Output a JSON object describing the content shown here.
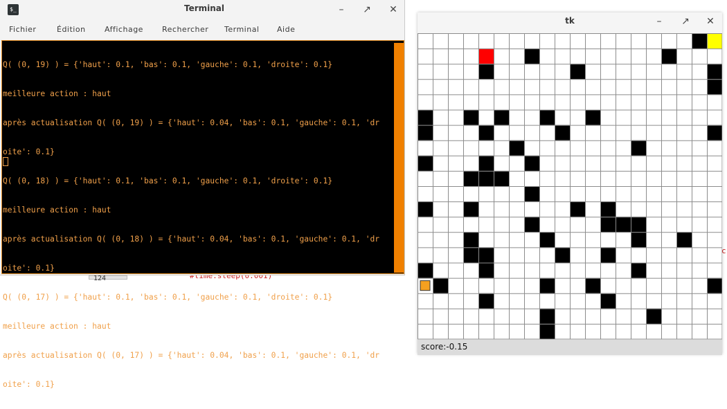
{
  "background": {
    "code_text": "#time.sleep(0.001)",
    "number_box": "124"
  },
  "terminal": {
    "title": "Terminal",
    "menu": [
      "Fichier",
      "Édition",
      "Affichage",
      "Rechercher",
      "Terminal",
      "Aide"
    ],
    "lines": [
      "Q( (0, 19) ) = {'haut': 0.1, 'bas': 0.1, 'gauche': 0.1, 'droite': 0.1}",
      "meilleure action : haut",
      "après actualisation Q( (0, 19) ) = {'haut': 0.04, 'bas': 0.1, 'gauche': 0.1, 'dr",
      "oite': 0.1}",
      "Q( (0, 18) ) = {'haut': 0.1, 'bas': 0.1, 'gauche': 0.1, 'droite': 0.1}",
      "meilleure action : haut",
      "après actualisation Q( (0, 18) ) = {'haut': 0.04, 'bas': 0.1, 'gauche': 0.1, 'dr",
      "oite': 0.1}",
      "Q( (0, 17) ) = {'haut': 0.1, 'bas': 0.1, 'gauche': 0.1, 'droite': 0.1}",
      "meilleure action : haut",
      "après actualisation Q( (0, 17) ) = {'haut': 0.04, 'bas': 0.1, 'gauche': 0.1, 'dr",
      "oite': 0.1}"
    ],
    "text_color": "#f0a04a",
    "accent": "#f08000"
  },
  "tk": {
    "title": "tk",
    "score_label": "score:-0.15",
    "grid": {
      "cols": 20,
      "rows": 20,
      "walls": [
        [
          0,
          5
        ],
        [
          0,
          6
        ],
        [
          0,
          8
        ],
        [
          0,
          11
        ],
        [
          0,
          15
        ],
        [
          1,
          16
        ],
        [
          3,
          5
        ],
        [
          3,
          9
        ],
        [
          3,
          11
        ],
        [
          3,
          13
        ],
        [
          3,
          14
        ],
        [
          4,
          2
        ],
        [
          4,
          6
        ],
        [
          4,
          8
        ],
        [
          4,
          9
        ],
        [
          4,
          14
        ],
        [
          4,
          15
        ],
        [
          4,
          17
        ],
        [
          5,
          5
        ],
        [
          5,
          9
        ],
        [
          6,
          7
        ],
        [
          7,
          1
        ],
        [
          7,
          8
        ],
        [
          7,
          10
        ],
        [
          7,
          12
        ],
        [
          8,
          5
        ],
        [
          8,
          13
        ],
        [
          8,
          16
        ],
        [
          8,
          18
        ],
        [
          8,
          19
        ],
        [
          9,
          6
        ],
        [
          9,
          14
        ],
        [
          10,
          2
        ],
        [
          10,
          11
        ],
        [
          11,
          5
        ],
        [
          11,
          16
        ],
        [
          12,
          11
        ],
        [
          12,
          12
        ],
        [
          12,
          14
        ],
        [
          12,
          17
        ],
        [
          13,
          12
        ],
        [
          14,
          7
        ],
        [
          14,
          12
        ],
        [
          14,
          13
        ],
        [
          14,
          15
        ],
        [
          15,
          18
        ],
        [
          16,
          1
        ],
        [
          17,
          13
        ],
        [
          18,
          0
        ],
        [
          19,
          2
        ],
        [
          19,
          3
        ],
        [
          19,
          6
        ],
        [
          19,
          16
        ]
      ],
      "red_cells": [
        [
          4,
          1
        ]
      ],
      "yellow_cells": [
        [
          19,
          0
        ]
      ],
      "agent_cell": [
        0,
        16
      ],
      "colors": {
        "wall": "#000000",
        "red": "#ff0000",
        "yellow": "#ffff00",
        "agent": "#f5a020",
        "cell": "#ffffff",
        "line": "#8c8c8c"
      }
    }
  }
}
